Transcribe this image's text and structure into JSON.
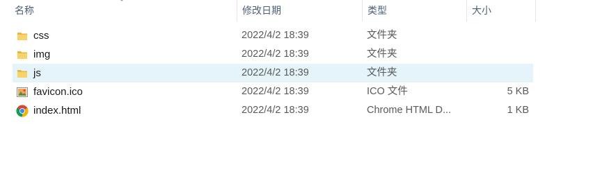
{
  "columns": {
    "name": "名称",
    "date": "修改日期",
    "type": "类型",
    "size": "大小"
  },
  "files": [
    {
      "name": "css",
      "date": "2022/4/2 18:39",
      "type": "文件夹",
      "size": "",
      "icon": "folder-icon",
      "selected": false
    },
    {
      "name": "img",
      "date": "2022/4/2 18:39",
      "type": "文件夹",
      "size": "",
      "icon": "folder-icon",
      "selected": false
    },
    {
      "name": "js",
      "date": "2022/4/2 18:39",
      "type": "文件夹",
      "size": "",
      "icon": "folder-icon",
      "selected": true
    },
    {
      "name": "favicon.ico",
      "date": "2022/4/2 18:39",
      "type": "ICO 文件",
      "size": "5 KB",
      "icon": "image-file-icon",
      "selected": false
    },
    {
      "name": "index.html",
      "date": "2022/4/2 18:39",
      "type": "Chrome HTML D...",
      "size": "1 KB",
      "icon": "chrome-icon",
      "selected": false
    }
  ],
  "colors": {
    "selected_row": "#e5f3fb",
    "folder": "#f8d26a",
    "header_text": "#4c607a"
  }
}
